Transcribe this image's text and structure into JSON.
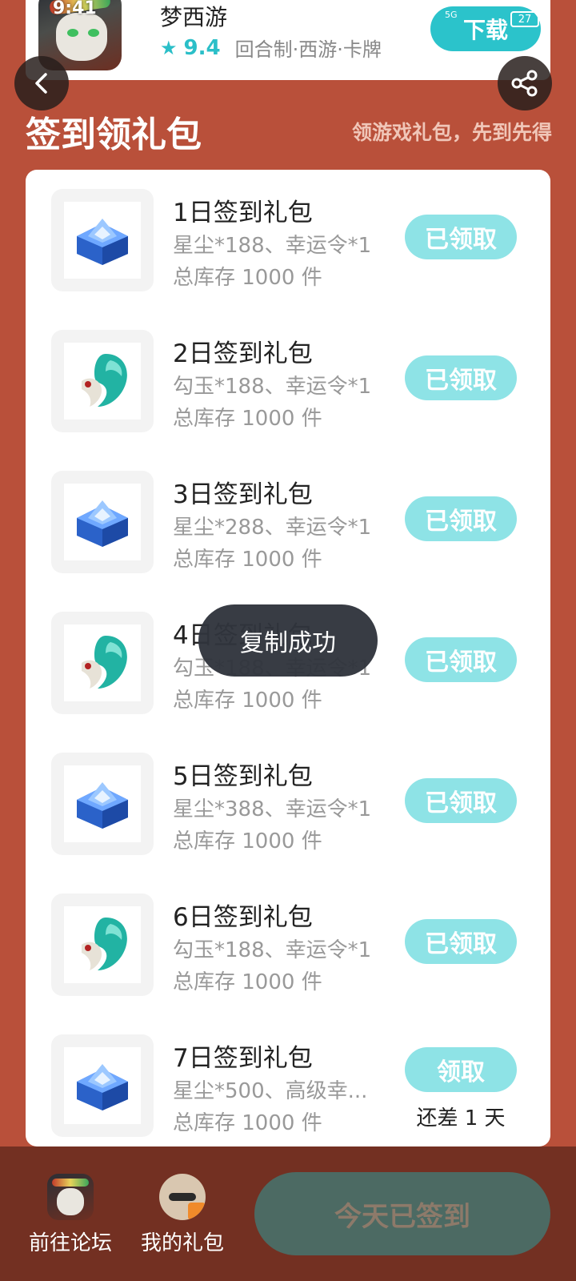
{
  "game": {
    "name": "梦西游",
    "score": "9.4",
    "tags": "回合制·西游·卡牌",
    "download_label": "下载",
    "status_time": "9:41",
    "battery": "27"
  },
  "header": {
    "title": "签到领礼包",
    "subtitle": "领游戏礼包，先到先得"
  },
  "gifts": [
    {
      "title": "1日签到礼包",
      "desc": "星尘*188、幸运令*1",
      "stock": "总库存 1000 件",
      "button": "已领取",
      "icon": "blue-crystal-chest-icon"
    },
    {
      "title": "2日签到礼包",
      "desc": "勾玉*188、幸运令*1",
      "stock": "总库存 1000 件",
      "button": "已领取",
      "icon": "jade-magatama-icon"
    },
    {
      "title": "3日签到礼包",
      "desc": "星尘*288、幸运令*1",
      "stock": "总库存 1000 件",
      "button": "已领取",
      "icon": "blue-crystal-chest-icon"
    },
    {
      "title": "4日签到礼包",
      "desc": "勾玉*188、幸运令*1",
      "stock": "总库存 1000 件",
      "button": "已领取",
      "icon": "jade-magatama-icon"
    },
    {
      "title": "5日签到礼包",
      "desc": "星尘*388、幸运令*1",
      "stock": "总库存 1000 件",
      "button": "已领取",
      "icon": "blue-crystal-chest-icon"
    },
    {
      "title": "6日签到礼包",
      "desc": "勾玉*188、幸运令*1",
      "stock": "总库存 1000 件",
      "button": "已领取",
      "icon": "jade-magatama-icon"
    },
    {
      "title": "7日签到礼包",
      "desc": "星尘*500、高级幸...",
      "stock": "总库存 1000 件",
      "button": "领取",
      "remain": "还差 1 天",
      "icon": "blue-crystal-chest-icon"
    }
  ],
  "toast": "复制成功",
  "bottom": {
    "forum_label": "前往论坛",
    "mygift_label": "我的礼包",
    "signed_label": "今天已签到"
  },
  "colors": {
    "background": "#b9503a",
    "accent": "#2bc3cb",
    "button_light": "#8ee3e6",
    "bottom_bar": "#733022"
  }
}
